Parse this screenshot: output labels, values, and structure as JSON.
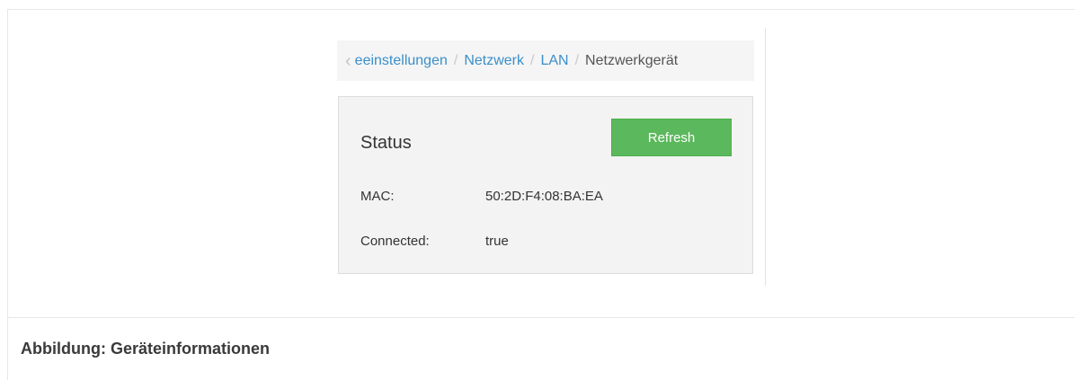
{
  "breadcrumb": {
    "items": [
      "Geräteeinstellungen",
      "Netzwerk",
      "LAN"
    ],
    "current": "Netzwerkgerät",
    "visible_first": "eeinstellungen",
    "separator": "/"
  },
  "status_panel": {
    "title": "Status",
    "refresh_label": "Refresh",
    "rows": [
      {
        "label": "MAC:",
        "value": "50:2D:F4:08:BA:EA"
      },
      {
        "label": "Connected:",
        "value": "true"
      }
    ]
  },
  "caption": "Abbildung: Geräteinformationen",
  "colors": {
    "link": "#3a8fc9",
    "button": "#5cb85c"
  }
}
